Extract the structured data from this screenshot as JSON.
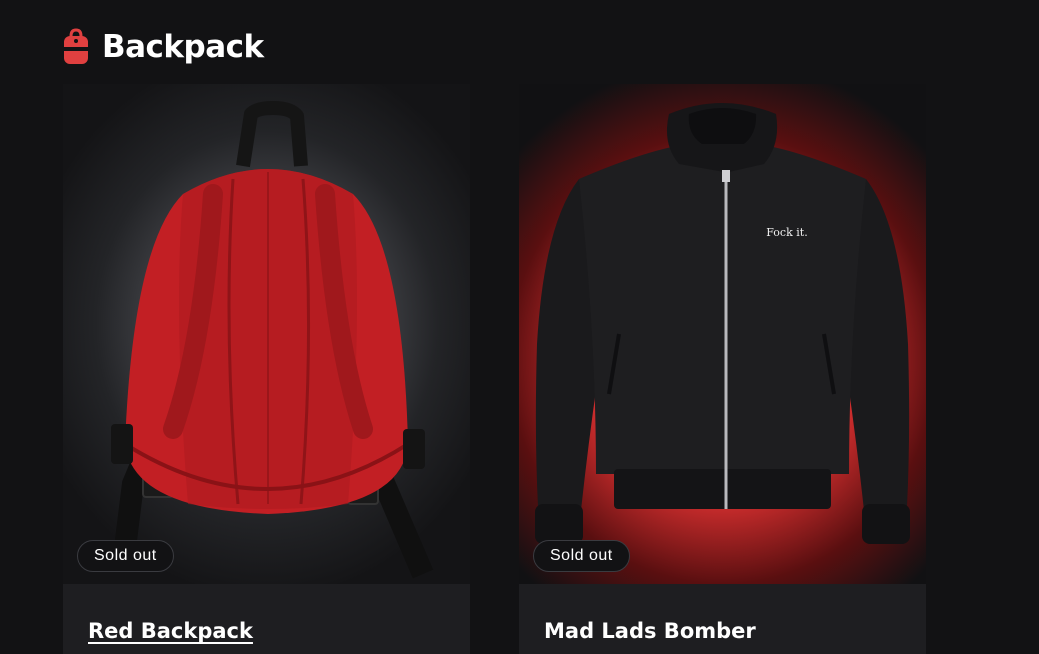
{
  "store": {
    "name": "Backpack",
    "icon": "backpack-icon",
    "accent_color": "#e04040"
  },
  "products": [
    {
      "title": "Red Backpack",
      "badge": "Sold out",
      "image": "red-backpack-image",
      "color": "#c21f24"
    },
    {
      "title": "Mad Lads Bomber",
      "badge": "Sold out",
      "image": "black-bomber-jacket-image",
      "chest_print": "Fock it.",
      "color": "#1a1a1c"
    }
  ]
}
